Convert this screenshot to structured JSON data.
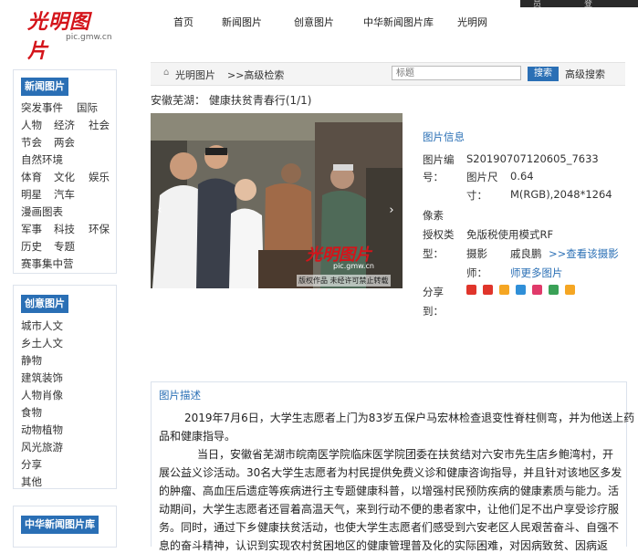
{
  "header": {
    "logo_brand": "光明图片",
    "logo_domain": "pic.gmw.cn",
    "nav": [
      "首页",
      "新闻图片",
      "创意图片",
      "中华新闻图片库",
      "光明网"
    ],
    "corner_a": "员",
    "corner_b": "登"
  },
  "sidebar": {
    "sections": [
      {
        "title": "新闻图片",
        "items": [
          "突发事件",
          "国际",
          "人物",
          "经济",
          "社会",
          "节会",
          "两会",
          "自然环境",
          "体育",
          "文化",
          "娱乐",
          "明星",
          "汽车",
          "漫画图表",
          "军事",
          "科技",
          "环保",
          "历史",
          "专题",
          "赛事集中营"
        ]
      },
      {
        "title": "创意图片",
        "items": [
          "城市人文",
          "乡土人文",
          "静物",
          "建筑装饰",
          "人物肖像",
          "食物",
          "动物植物",
          "风光旅游",
          "分享",
          "其他"
        ]
      },
      {
        "title": "中华新闻图片库",
        "items": []
      }
    ]
  },
  "breadcrumb": {
    "home_icon": "home-icon",
    "items": [
      "光明图片",
      ">>高级检索"
    ],
    "search_placeholder": "标题",
    "search_button": "搜索",
    "advanced": "高级搜索"
  },
  "photo_title": "安徽芜湖： 健康扶贫青春行(1/1)",
  "photo": {
    "watermark_brand": "光明图片",
    "watermark_domain": "pic.gmw.cn",
    "copyright": "版权作品  未经许可禁止转载",
    "prev_label": "‹",
    "next_label": "›"
  },
  "info": {
    "heading": "图片信息",
    "id_label": "图片编号：",
    "id_label_a": "图片编",
    "id_label_b": "号：",
    "id_value": "S20190707120605_7633",
    "size_label_a": "图片尺",
    "size_label_b": "寸：",
    "size_value_1": "0.64",
    "size_value_2": "M(RGB),2048*1264",
    "size_value_3": "像素",
    "license_label_a": "授权类",
    "license_label_b": "型：",
    "license_value": "免版税使用模式RF",
    "photographer_label_a": "摄影",
    "photographer_label_b": "师：",
    "photographer_value": "戚良鹏",
    "view_photographer": ">>查看该摄影",
    "more_photos": "师更多图片",
    "share_label_a": "分享",
    "share_label_b": "到：",
    "share_icons": [
      {
        "name": "weibo-icon",
        "color": "#e0352b"
      },
      {
        "name": "tencent-weibo-icon",
        "color": "#e0352b"
      },
      {
        "name": "qzone-icon",
        "color": "#f5a623"
      },
      {
        "name": "renren-icon",
        "color": "#2f8fd8"
      },
      {
        "name": "kaixin-icon",
        "color": "#e03a6a"
      },
      {
        "name": "douban-icon",
        "color": "#3aa157"
      },
      {
        "name": "more-icon",
        "color": "#f5a623"
      }
    ]
  },
  "description": {
    "heading": "图片描述",
    "lines": [
      "2019年7月6日，大学生志愿者上门为83岁五保户马宏林检查退变性脊柱侧弯，并为他送上药",
      "品和健康指导。",
      "当日，安徽省芜湖市皖南医学院临床医学院团委在扶贫结对六安市先生店乡鲍湾村，开",
      "展公益义诊活动。30名大学生志愿者为村民提供免费义诊和健康咨询指导，并且针对该地区多发",
      "的肿瘤、高血压后遗症等疾病进行主专题健康科普，以增强村民预防疾病的健康素质与能力。活",
      "动期间，大学生志愿者还冒着高温天气，来到行动不便的患者家中，让他们足不出户享受诊疗服",
      "务。同时，通过下乡健康扶贫活动，也使大学生志愿者们感受到六安老区人民艰苦奋斗、自强不",
      "息的奋斗精神，认识到实现农村贫困地区的健康管理普及化的实际困难，对因病致贫、因病返"
    ]
  },
  "colors": {
    "brand_red": "#d4141a",
    "accent_blue": "#2a6fb5"
  }
}
